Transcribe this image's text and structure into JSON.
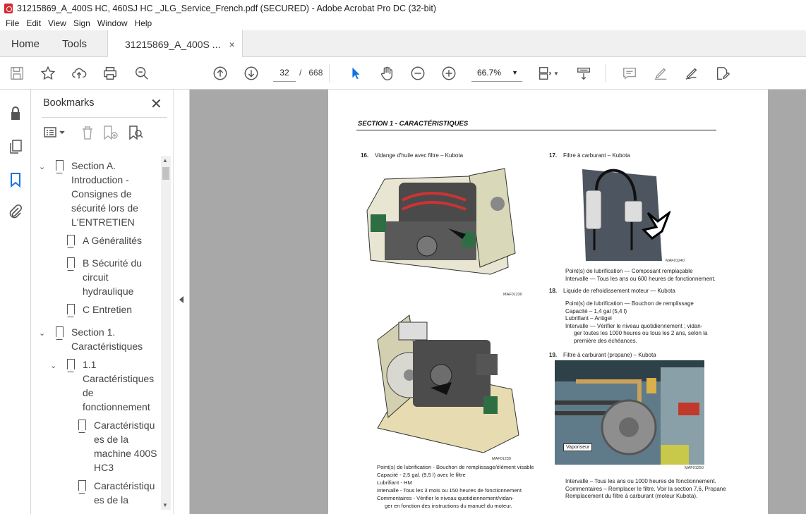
{
  "window": {
    "title": "31215869_A_400S HC, 460SJ HC _JLG_Service_French.pdf (SECURED) - Adobe Acrobat Pro DC (32-bit)"
  },
  "menu": [
    "File",
    "Edit",
    "View",
    "Sign",
    "Window",
    "Help"
  ],
  "tabs": {
    "home": "Home",
    "tools": "Tools",
    "doc": "31215869_A_400S ...",
    "close": "×"
  },
  "toolbar": {
    "page_current": "32",
    "page_sep": "/",
    "page_total": "668",
    "zoom": "66.7%"
  },
  "bookmarks": {
    "title": "Bookmarks",
    "items": [
      {
        "lines": [
          "Section A.",
          "Introduction -",
          "Consignes de",
          "sécurité lors de",
          "L'ENTRETIEN"
        ]
      },
      {
        "lines": [
          "A Généralités"
        ]
      },
      {
        "lines": [
          "B Sécurité du",
          "circuit",
          "hydraulique"
        ]
      },
      {
        "lines": [
          "C Entretien"
        ]
      },
      {
        "lines": [
          "Section 1.",
          "Caractéristiques"
        ]
      },
      {
        "lines": [
          "1.1",
          "Caractéristiques",
          "de",
          "fonctionnement"
        ]
      },
      {
        "lines": [
          "Caractéristiqu",
          "es de la",
          "machine 400S",
          "HC3"
        ]
      },
      {
        "lines": [
          "Caractéristiqu",
          "es de la"
        ]
      }
    ]
  },
  "document": {
    "section_header": "SECTION 1 - CARACTÉRISTIQUES",
    "item16": {
      "num": "16.",
      "title": "Vidange d'huile avec filtre – Kubota",
      "code1": "MAF01230",
      "code2": "MAF01230",
      "lines": [
        "Point(s) de lubrification - Bouchon de remplissage/élément visable",
        "Capacité - 2,5 gal. (9,5 l) avec le filtre",
        "Lubrifiant - HM",
        "Intervalle - Tous les 3 mois ou 150 heures de fonctionnement",
        "Commentaires - Vérifier le niveau quotidiennement/vidan-",
        "ger en fonction des instructions du manuel du moteur."
      ]
    },
    "item17": {
      "num": "17.",
      "title": "Filtre à carburant – Kubota",
      "code": "MAF01240",
      "lines": [
        "Point(s) de lubrification — Composant remplaçable",
        "Intervalle — Tous les ans ou 600 heures de fonctionnement."
      ]
    },
    "item18": {
      "num": "18.",
      "title": "Liquide de refroidissement moteur — Kubota",
      "lines": [
        "Point(s) de lubrification — Bouchon de remplissage",
        "Capacité – 1,4 gal (5,4 l)",
        "Lubrifiant – Antigel",
        "Intervalle — Vérifier le niveau quotidiennement ; vidan-",
        "ger toutes les 1000 heures ou tous les 2 ans, selon la",
        "première des échéances."
      ]
    },
    "item19": {
      "num": "19.",
      "title": "Filtre à carburant (propane) – Kubota",
      "code": "MAF01250",
      "label": "Vaporiseur",
      "lines": [
        "Intervalle – Tous les ans ou 1000 heures de fonctionnement.",
        "Commentaires – Remplacer le filtre. Voir la section 7,6, Propane",
        "Remplacement du filtre à carburant (moteur Kubota)."
      ]
    }
  }
}
